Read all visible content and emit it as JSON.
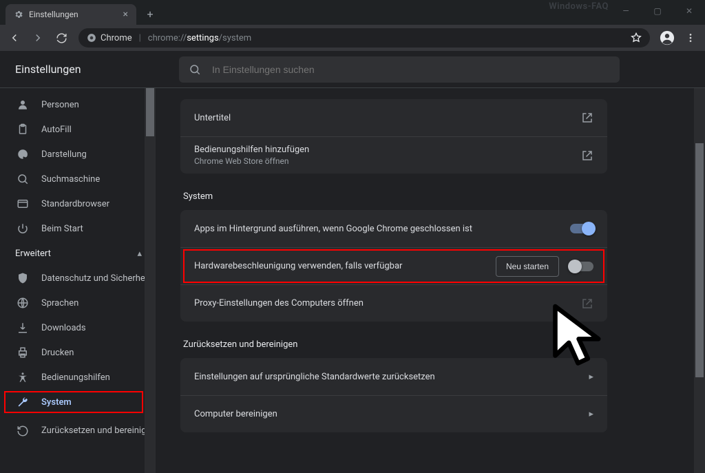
{
  "window": {
    "watermark": "Windows-FAQ"
  },
  "tab": {
    "title": "Einstellungen"
  },
  "omnibox": {
    "secure_label": "Chrome",
    "url_prefix": "chrome://",
    "url_bold": "settings",
    "url_suffix": "/system"
  },
  "page": {
    "title": "Einstellungen",
    "search_placeholder": "In Einstellungen suchen"
  },
  "sidebar": {
    "items": [
      {
        "label": "Personen"
      },
      {
        "label": "AutoFill"
      },
      {
        "label": "Darstellung"
      },
      {
        "label": "Suchmaschine"
      },
      {
        "label": "Standardbrowser"
      },
      {
        "label": "Beim Start"
      }
    ],
    "advanced_label": "Erweitert",
    "adv_items": [
      {
        "label": "Datenschutz und Sicherheit"
      },
      {
        "label": "Sprachen"
      },
      {
        "label": "Downloads"
      },
      {
        "label": "Drucken"
      },
      {
        "label": "Bedienungshilfen"
      },
      {
        "label": "System"
      },
      {
        "label": "Zurücksetzen und bereinigen"
      }
    ]
  },
  "groups": {
    "prev": {
      "untertitel": "Untertitel",
      "add_a11y_title": "Bedienungshilfen hinzufügen",
      "add_a11y_sub": "Chrome Web Store öffnen"
    },
    "system": {
      "title": "System",
      "background": "Apps im Hintergrund ausführen, wenn Google Chrome geschlossen ist",
      "hw": "Hardwarebeschleunigung verwenden, falls verfügbar",
      "restart": "Neu starten",
      "proxy": "Proxy-Einstellungen des Computers öffnen"
    },
    "reset": {
      "title": "Zurücksetzen und bereinigen",
      "defaults": "Einstellungen auf ursprüngliche Standardwerte zurücksetzen",
      "cleanup": "Computer bereinigen"
    }
  }
}
